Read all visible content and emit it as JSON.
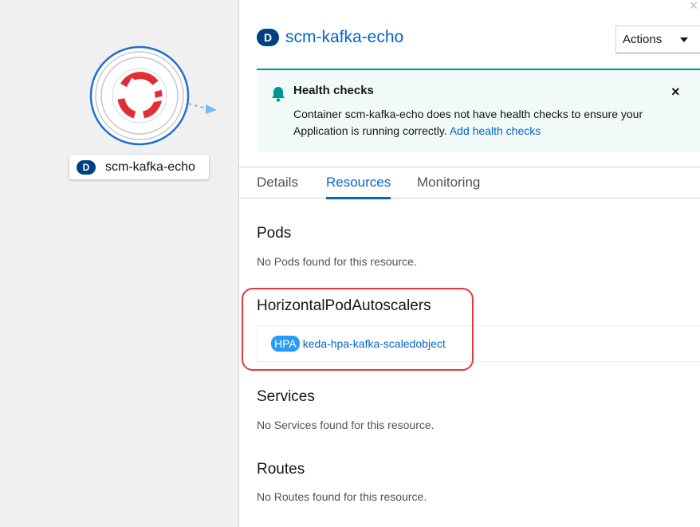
{
  "topology": {
    "node_badge": "D",
    "node_label": "scm-kafka-echo"
  },
  "panel": {
    "close_glyph": "×",
    "title_badge": "D",
    "title": "scm-kafka-echo",
    "actions_label": "Actions"
  },
  "alert": {
    "title": "Health checks",
    "message": "Container scm-kafka-echo does not have health checks to ensure your Application is running correctly.",
    "link": "Add health checks",
    "close_glyph": "×"
  },
  "tabs": [
    {
      "label": "Details",
      "active": false
    },
    {
      "label": "Resources",
      "active": true
    },
    {
      "label": "Monitoring",
      "active": false
    }
  ],
  "resources": {
    "pods": {
      "title": "Pods",
      "empty": "No Pods found for this resource."
    },
    "hpa": {
      "title": "HorizontalPodAutoscalers",
      "badge": "HPA",
      "link": "keda-hpa-kafka-scaledobject"
    },
    "services": {
      "title": "Services",
      "empty": "No Services found for this resource."
    },
    "routes": {
      "title": "Routes",
      "empty": "No Routes found for this resource."
    }
  },
  "colors": {
    "link": "#0066cc",
    "badge_dark": "#004080",
    "alert_accent": "#009596",
    "hpa_badge": "#2b9af3",
    "highlight": "#e0393e",
    "openshift_red": "#e12d34"
  },
  "icons": {
    "bell": "bell-icon",
    "caret": "caret-down-icon",
    "logo": "openshift-logo"
  }
}
